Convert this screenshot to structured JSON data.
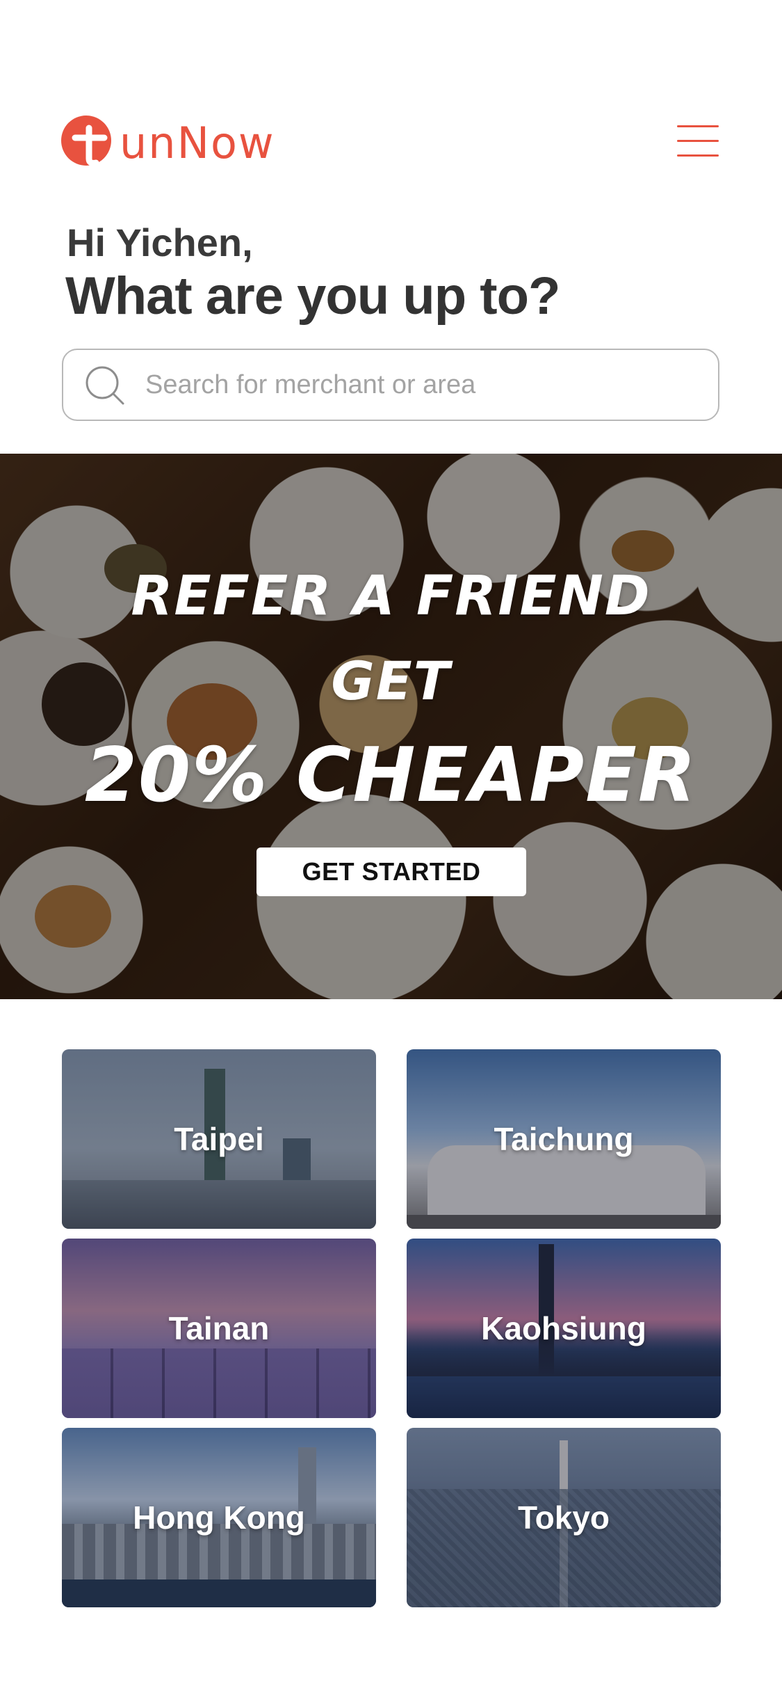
{
  "brand": {
    "name": "unNow",
    "accent_color": "#e8523f"
  },
  "greeting": "Hi Yichen,",
  "headline": "What are you up to?",
  "search": {
    "placeholder": "Search for merchant or area",
    "value": ""
  },
  "promo": {
    "line1": "Refer a friend",
    "line2": "Get",
    "line3": "20% cheaper",
    "cta_label": "GET STARTED"
  },
  "cities": [
    {
      "name": "Taipei"
    },
    {
      "name": "Taichung"
    },
    {
      "name": "Tainan"
    },
    {
      "name": "Kaohsiung"
    },
    {
      "name": "Hong Kong"
    },
    {
      "name": "Tokyo"
    }
  ]
}
